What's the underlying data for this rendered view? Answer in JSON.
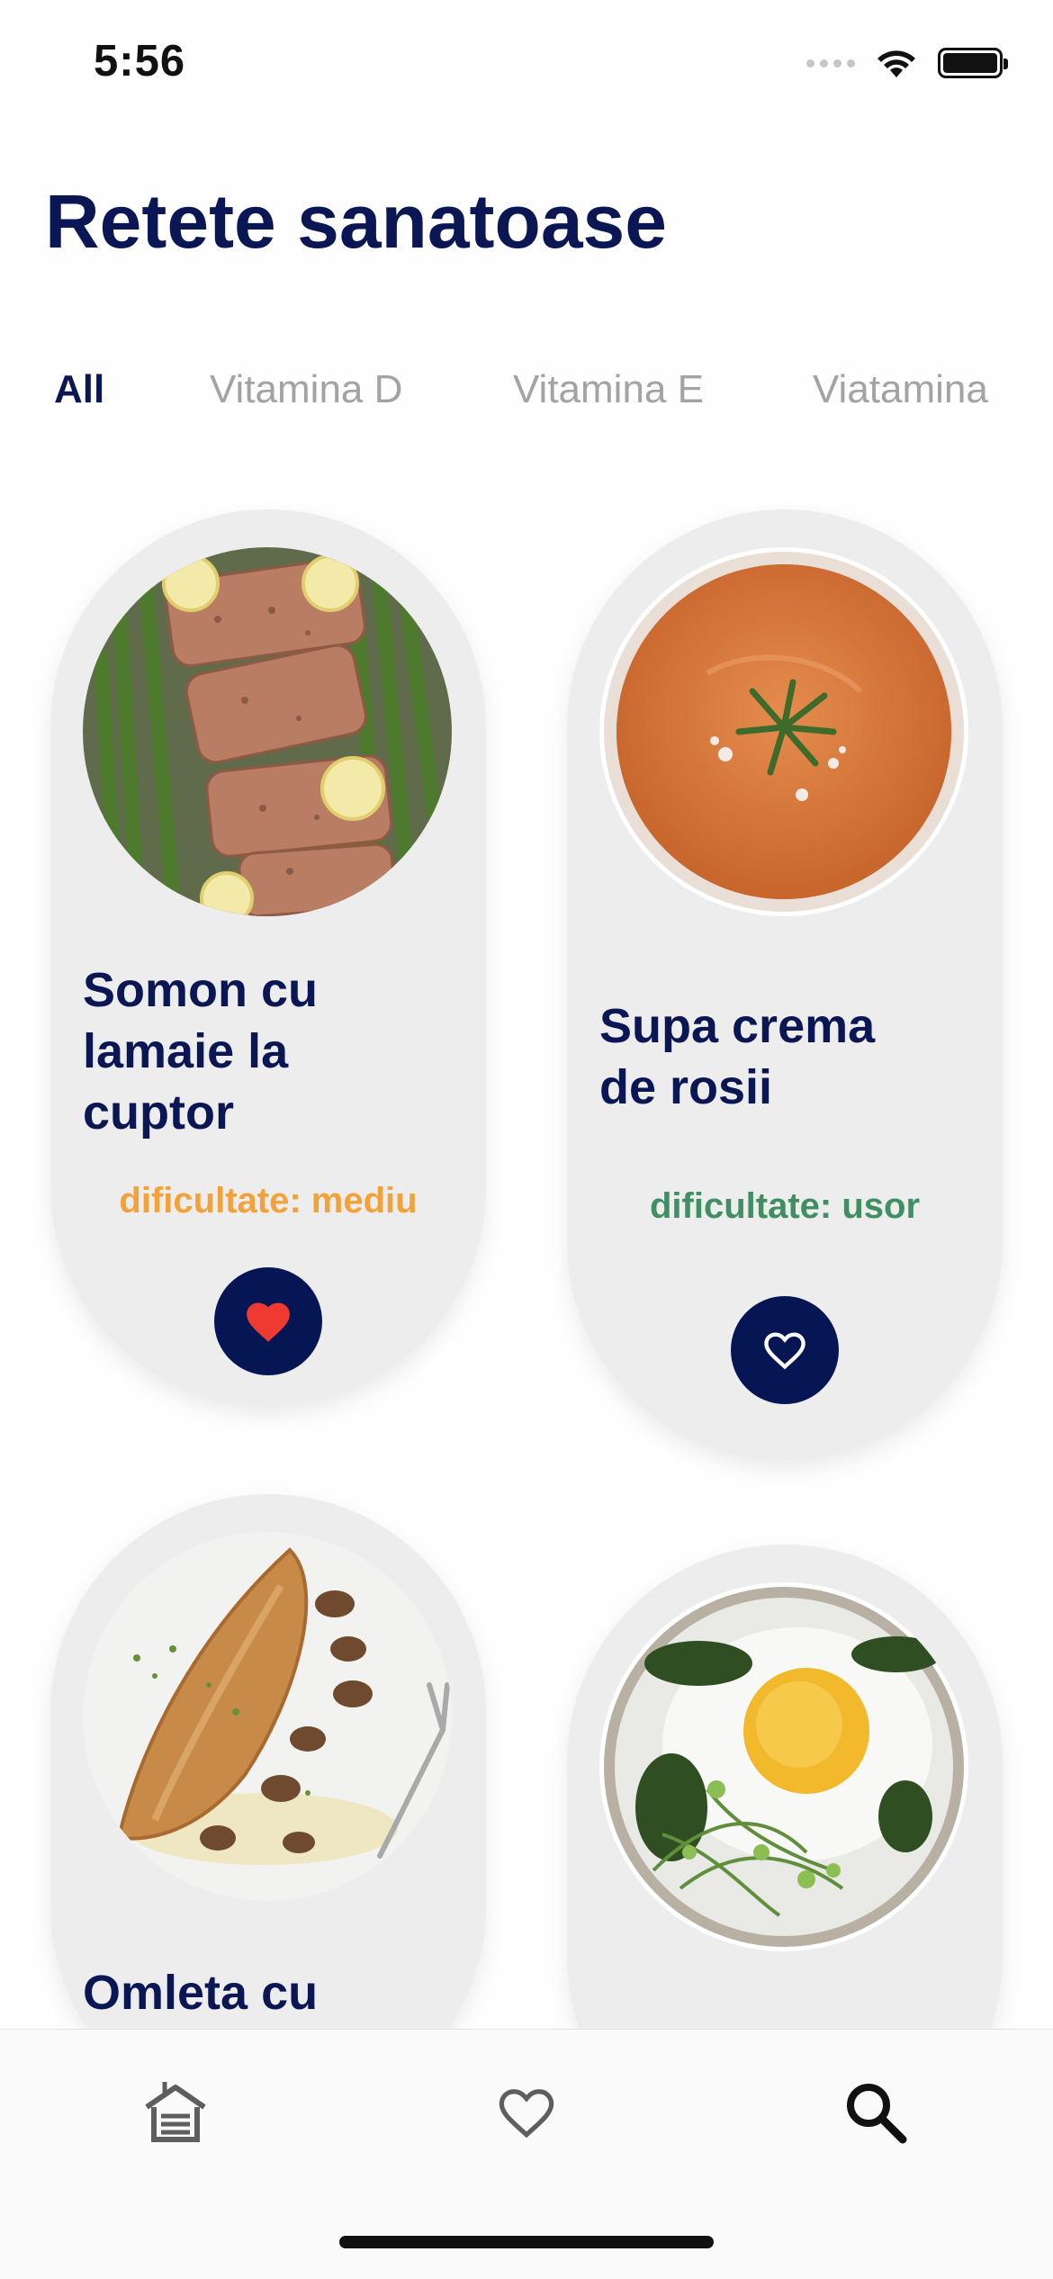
{
  "status_bar": {
    "time": "5:56"
  },
  "page": {
    "title": "Retete sanatoase"
  },
  "tabs": [
    {
      "label": "All",
      "active": true
    },
    {
      "label": "Vitamina D",
      "active": false
    },
    {
      "label": "Vitamina E",
      "active": false
    },
    {
      "label": "Viatamina",
      "active": false
    }
  ],
  "recipes": [
    {
      "title_lines": [
        "Somon cu",
        "lamaie la",
        "cuptor"
      ],
      "difficulty": "dificultate: mediu",
      "difficulty_color": "#f3a23a",
      "favorite": true,
      "image": "salmon-asparagus-photo"
    },
    {
      "title_lines": [
        "Supa crema",
        "de rosii"
      ],
      "difficulty": "dificultate: usor",
      "difficulty_color": "#3f8f63",
      "favorite": false,
      "image": "tomato-soup-photo"
    },
    {
      "title_lines": [
        "Omleta cu"
      ],
      "image": "omelette-mushrooms-photo"
    },
    {
      "image": "baked-egg-greens-photo"
    }
  ],
  "bottom_nav": [
    {
      "icon": "home-icon"
    },
    {
      "icon": "heart-icon"
    },
    {
      "icon": "search-icon",
      "active": true
    }
  ],
  "colors": {
    "primary": "#0b1754",
    "card_bg": "#ededed",
    "favorite_red": "#ee3a30",
    "medium": "#f3a23a",
    "easy": "#3f8f63"
  }
}
